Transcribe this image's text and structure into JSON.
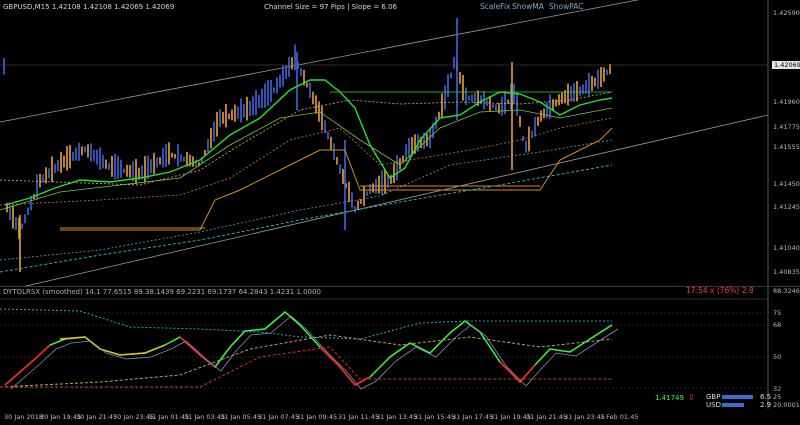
{
  "header": {
    "symbol": "GBPUSD,M15",
    "ohlc": "1.42108 1.42108 1.42069 1.42069",
    "channel_info": "Channel Size = 97 Pips  |  Slope = 6.06"
  },
  "controls": {
    "scalefix": "ScaleFix",
    "showma": "ShowMA",
    "showpac": "ShowPAC"
  },
  "price_axis": [
    "1.42590",
    "1.42065",
    "1.41960",
    "1.41775",
    "1.41555",
    "1.41450",
    "1.41245",
    "1.41040",
    "1.40835"
  ],
  "current_price": "1.42069",
  "oscillator": {
    "title": "DYTOLRSX (smoothed) 14,1  77.6515 89.38.1439 69.2231 69.1737 64.2843 1.4231 1.0000",
    "timer": "17:54 x (76%) 2.8",
    "axis": [
      "88.3246",
      "75",
      "68",
      "50",
      "32",
      "25",
      "20.0001"
    ],
    "price_readout": "1.41749",
    "currencies": [
      {
        "name": "GBP",
        "value": "6.5",
        "fill": 0.85
      },
      {
        "name": "USD",
        "value": "2.9",
        "fill": 0.6
      }
    ]
  },
  "time_axis": [
    "30 Jan 2018",
    "30 Jan 19:45",
    "30 Jan 21:45",
    "30 Jan 23:45",
    "31 Jan 01:45",
    "31 Jan 03:45",
    "31 Jan 05:45",
    "31 Jan 07:45",
    "31 Jan 09:45",
    "31 Jan 11:45",
    "31 Jan 13:45",
    "31 Jan 15:45",
    "31 Jan 17:45",
    "31 Jan 19:45",
    "31 Jan 21:45",
    "31 Jan 23:45",
    "1 Feb 01:45"
  ],
  "colors": {
    "bull": "#3d67e0",
    "bear": "#f0a030",
    "ma_green": "#22e22a",
    "channel": "#9a9a9a",
    "teal": "#2aa8b8",
    "orange_line": "#d98a22",
    "rsx_green": "#33ff33",
    "rsx_red": "#ff2020",
    "rsx_yellow": "#e8c020"
  }
}
